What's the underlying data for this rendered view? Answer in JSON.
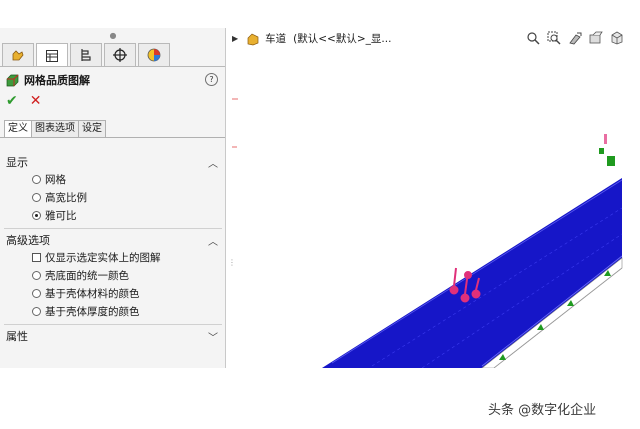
{
  "property_manager": {
    "tabs": [
      {
        "icon": "feature-manager-icon"
      },
      {
        "icon": "property-manager-icon"
      },
      {
        "icon": "configuration-manager-icon"
      },
      {
        "icon": "dimxpert-icon"
      },
      {
        "icon": "display-manager-icon"
      }
    ],
    "title": "网格品质图解",
    "help": "?",
    "ok_symbol": "✔",
    "cancel_symbol": "✕",
    "subtabs": [
      "定义",
      "图表选项",
      "设定"
    ],
    "active_subtab": "定义",
    "sections": {
      "display": {
        "label": "显示",
        "options": [
          {
            "label": "网格",
            "checked": false
          },
          {
            "label": "高宽比例",
            "checked": false
          },
          {
            "label": "雅可比",
            "checked": true
          }
        ]
      },
      "advanced": {
        "label": "高级选项",
        "checkbox_label": "仅显示选定实体上的图解",
        "options": [
          {
            "label": "壳底面的统一颜色",
            "checked": false
          },
          {
            "label": "基于壳体材料的颜色",
            "checked": false
          },
          {
            "label": "基于壳体厚度的颜色",
            "checked": false
          }
        ]
      },
      "properties": {
        "label": "属性"
      }
    }
  },
  "viewport": {
    "doc_name": "车道",
    "config_text": "(默认<<默认>_显...",
    "mesh_color": "#1616c8",
    "fixture_color": "#1f9a1f",
    "load_color": "#e0307a"
  },
  "watermark": "头条 @数字化企业"
}
